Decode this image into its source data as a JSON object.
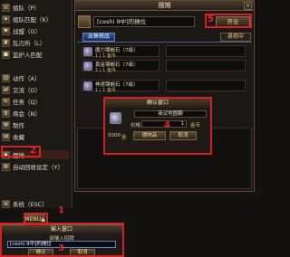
{
  "menu": {
    "items": [
      {
        "icon": "⚔",
        "label": "组队（P）"
      },
      {
        "icon": "✦",
        "label": "组队匹配（K）"
      },
      {
        "icon": "⚑",
        "label": "战盟（G）"
      },
      {
        "icon": "♜",
        "label": "乱刃所（L）"
      },
      {
        "icon": "☗",
        "label": "监护人匹配"
      },
      {
        "icon": "",
        "label": ""
      },
      {
        "icon": "☺",
        "label": "动作（A）"
      },
      {
        "icon": "⇄",
        "label": "交流（O）"
      },
      {
        "icon": "✎",
        "label": "任务（Q）"
      },
      {
        "icon": "$",
        "label": "商会（N）"
      },
      {
        "icon": "⚒",
        "label": "制作"
      },
      {
        "icon": "✉",
        "label": "收藏"
      },
      {
        "icon": "",
        "label": ""
      },
      {
        "icon": "♠",
        "label": "摆摊"
      },
      {
        "icon": "⚙",
        "label": "自动回收设定（Y）"
      },
      {
        "icon": "",
        "label": ""
      },
      {
        "icon": "≡",
        "label": "系统（ESC）"
      }
    ],
    "button_label": "MENU▲"
  },
  "stall": {
    "title": "摆摊",
    "close": "×",
    "name_value": "[ceshi 9中]的摊位",
    "start_button": "开业",
    "tab_sell": "出售物品",
    "msg_button": "悬观中",
    "slots": [
      {
        "name": "魔力镶嵌石（7级）",
        "qty": "1",
        "price": "1",
        "currency": "金币"
      },
      {
        "name": "",
        "qty": "",
        "price": "",
        "currency": ""
      },
      {
        "name": "黄金镶嵌石（7级）",
        "qty": "1",
        "price": "1",
        "currency": "金币"
      },
      {
        "name": "",
        "qty": "",
        "price": "",
        "currency": ""
      },
      {
        "name": "神速镶嵌石（7级）",
        "qty": "1",
        "price": "1",
        "currency": "金币"
      },
      {
        "name": "",
        "qty": "",
        "price": "",
        "currency": ""
      }
    ]
  },
  "confirm": {
    "title": "确认窗口",
    "item_name": "商议地图翻",
    "price_label": "价格",
    "price_value": "1",
    "currency": "金币",
    "money": "5000",
    "money_currency": "金",
    "stall_button": "摆物品",
    "cancel_button": "取消"
  },
  "input_dialog": {
    "title": "输入窗口",
    "prompt": "请输入招牌",
    "value": "[ceshi 9中]的摊位",
    "ok_button": "确认",
    "cancel_button": "取消"
  },
  "annotations": [
    "1",
    "2",
    "3",
    "4",
    "5"
  ],
  "colors": {
    "highlight": "#d42020",
    "gold": "#e0c060",
    "tab_blue": "#3a5a9a"
  }
}
